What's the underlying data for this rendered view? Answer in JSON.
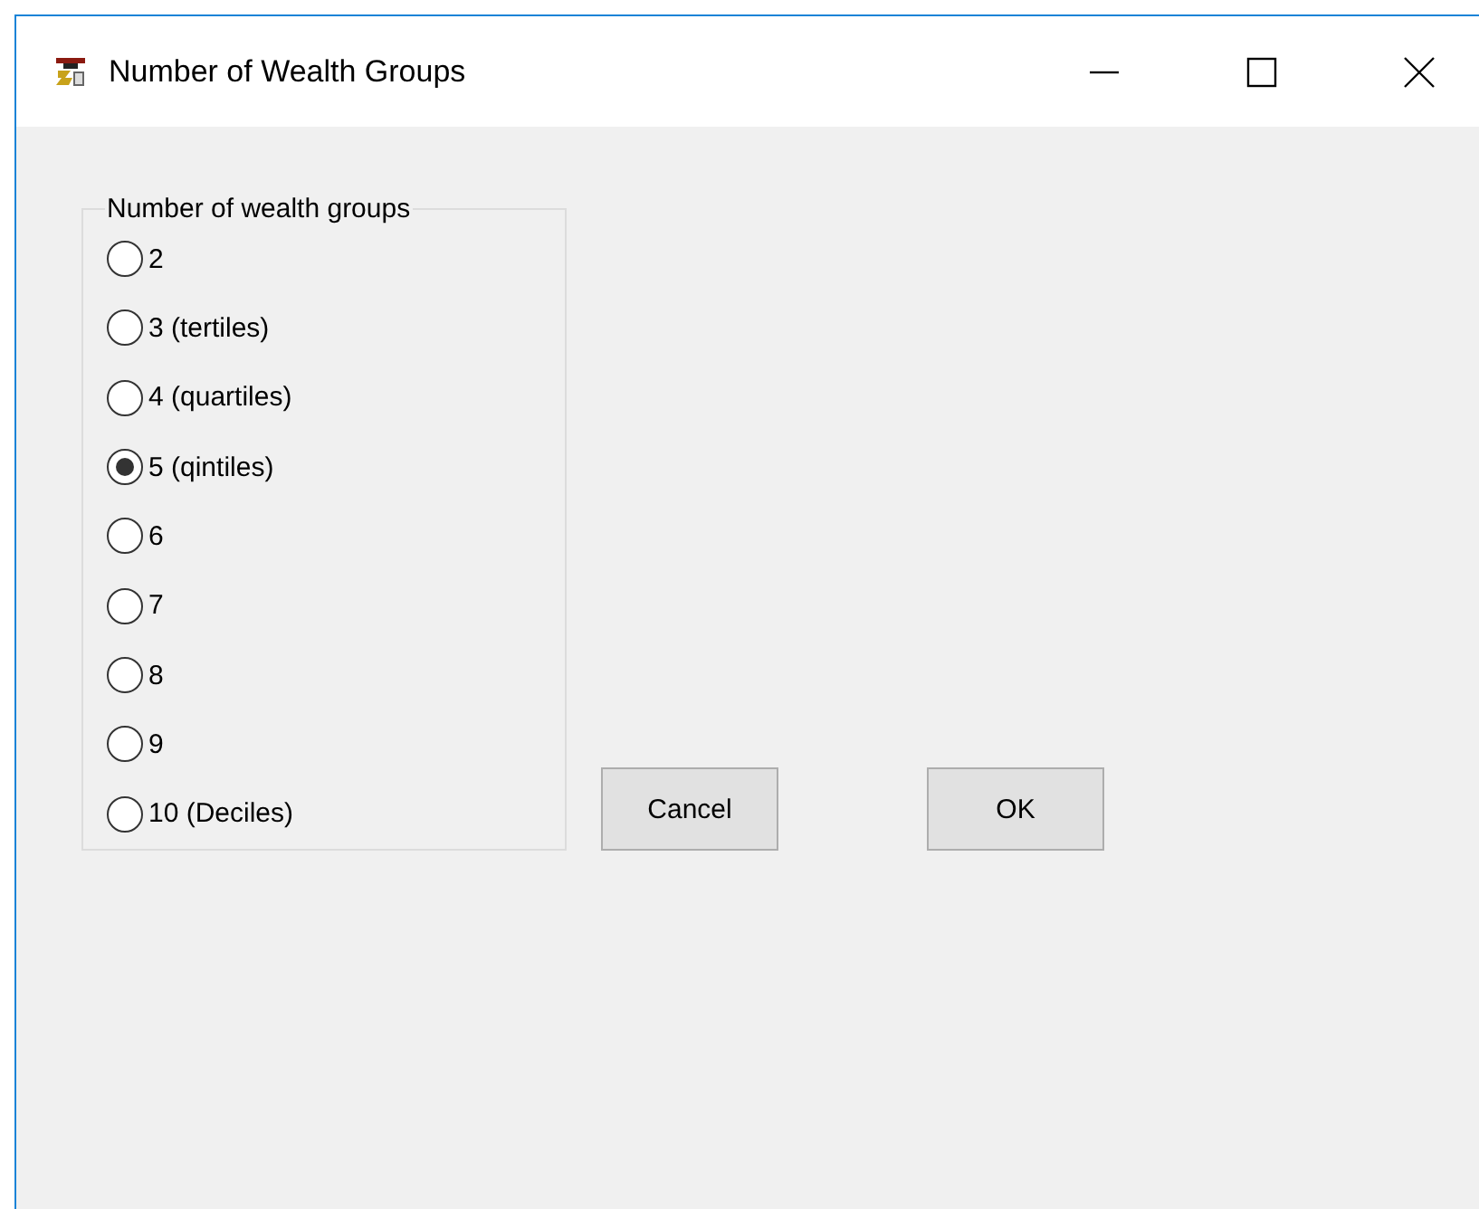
{
  "window": {
    "title": "Number of Wealth Groups"
  },
  "group": {
    "label": "Number of wealth groups",
    "options": [
      {
        "label": "2",
        "selected": false
      },
      {
        "label": "3 (tertiles)",
        "selected": false
      },
      {
        "label": "4 (quartiles)",
        "selected": false
      },
      {
        "label": "5 (qintiles)",
        "selected": true
      },
      {
        "label": "6",
        "selected": false
      },
      {
        "label": "7",
        "selected": false
      },
      {
        "label": "8",
        "selected": false
      },
      {
        "label": "9",
        "selected": false
      },
      {
        "label": "10 (Deciles)",
        "selected": false
      }
    ]
  },
  "buttons": [
    "Cancel",
    "OK"
  ]
}
